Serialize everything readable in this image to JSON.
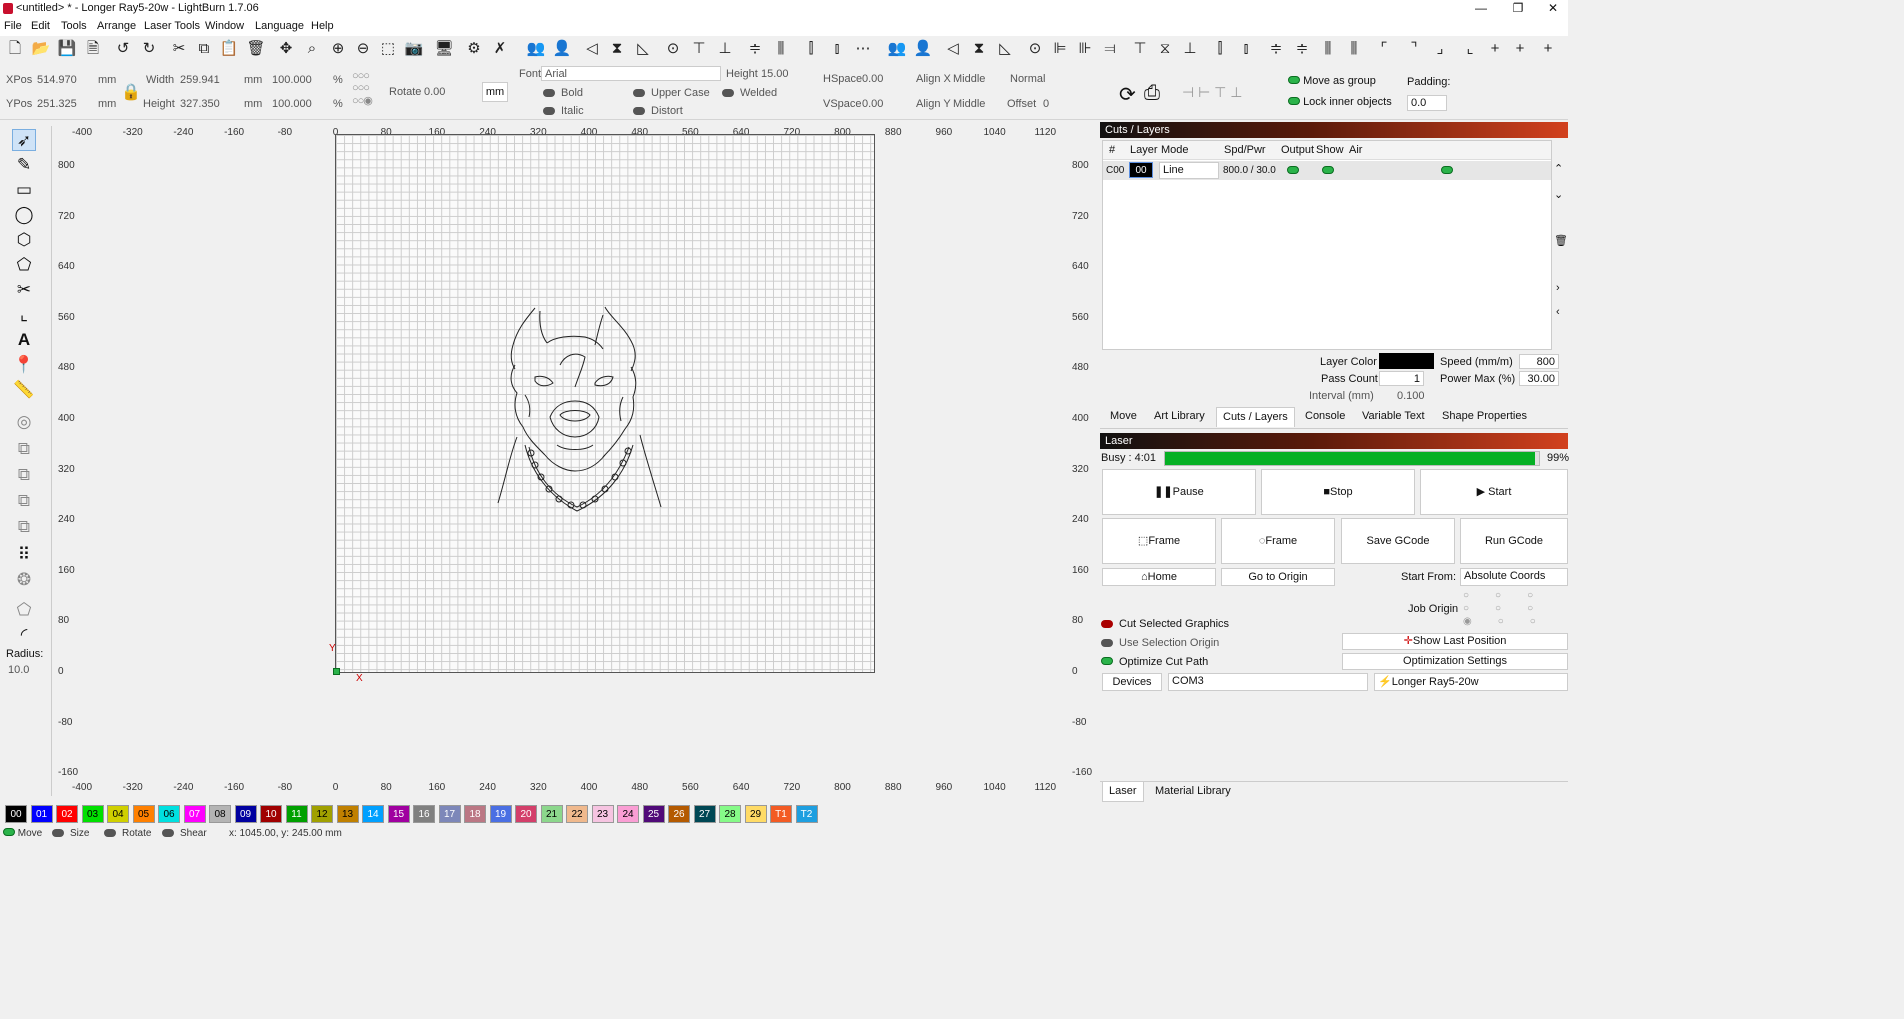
{
  "window": {
    "title": "<untitled> * - Longer Ray5-20w - LightBurn 1.7.06",
    "minimize": "—",
    "restore": "❐",
    "close": "✕"
  },
  "menu": [
    "File",
    "Edit",
    "Tools",
    "Arrange",
    "Laser Tools",
    "Window",
    "Language",
    "Help"
  ],
  "props": {
    "xpos_label": "XPos",
    "xpos": "514.970",
    "ypos_label": "YPos",
    "ypos": "251.325",
    "unit": "mm",
    "width_label": "Width",
    "width": "259.941",
    "height_label": "Height",
    "height": "327.350",
    "scale_w": "100.000",
    "scale_h": "100.000",
    "pct": "%",
    "rotate_label": "Rotate",
    "rotate": "0.00",
    "mm_btn": "mm",
    "font_label": "Font",
    "font": "Arial",
    "fheight_label": "Height",
    "fheight": "15.00",
    "hspace_label": "HSpace",
    "hspace": "0.00",
    "vspace_label": "VSpace",
    "vspace": "0.00",
    "alignx_label": "Align X",
    "alignx": "Middle",
    "aligny_label": "Align Y",
    "aligny": "Middle",
    "normal": "Normal",
    "offset_label": "Offset",
    "offset": "0",
    "bold": "Bold",
    "italic": "Italic",
    "upper": "Upper Case",
    "distort": "Distort",
    "welded": "Welded",
    "move_group": "Move as group",
    "lock_inner": "Lock inner objects",
    "padding_label": "Padding:",
    "padding": "0.0"
  },
  "ruler": {
    "top": [
      "-400",
      "-320",
      "-240",
      "-160",
      "-80",
      "0",
      "80",
      "160",
      "240",
      "320",
      "400",
      "480",
      "560",
      "640",
      "720",
      "800",
      "880",
      "960",
      "1040",
      "1120"
    ],
    "left": [
      "800",
      "720",
      "640",
      "560",
      "480",
      "400",
      "320",
      "240",
      "160",
      "80",
      "0",
      "-80",
      "-160"
    ]
  },
  "canvas": {
    "y_axis": "Y",
    "x_axis": "X"
  },
  "left": {
    "radius_label": "Radius:",
    "radius": "10.0"
  },
  "layers": {
    "title": "Cuts / Layers",
    "headers": [
      "#",
      "Layer",
      "Mode",
      "Spd/Pwr",
      "Output",
      "Show",
      "Air"
    ],
    "row": {
      "num": "C00",
      "layer": "00",
      "mode": "Line",
      "spdpwr": "800.0 / 30.0"
    },
    "layer_color_label": "Layer Color",
    "speed_label": "Speed (mm/m)",
    "speed": "800",
    "pass_label": "Pass Count",
    "pass": "1",
    "power_label": "Power Max (%)",
    "power": "30.00",
    "interval_label": "Interval (mm)",
    "interval": "0.100"
  },
  "tabs1": [
    "Move",
    "Art Library",
    "Cuts / Layers",
    "Console",
    "Variable Text",
    "Shape Properties"
  ],
  "laser": {
    "title": "Laser",
    "busy": "Busy : 4:01",
    "progress": 0.99,
    "progress_label": "99%",
    "pause": "Pause",
    "stop": "Stop",
    "start": "Start",
    "frame1": "Frame",
    "frame2": "Frame",
    "save_gcode": "Save GCode",
    "run_gcode": "Run GCode",
    "home": "Home",
    "go_origin": "Go to Origin",
    "start_from_label": "Start From:",
    "start_from": "Absolute Coords",
    "job_origin": "Job Origin",
    "cut_selected": "Cut Selected Graphics",
    "use_selection": "Use Selection Origin",
    "optimize": "Optimize Cut Path",
    "show_last": "Show Last Position",
    "opt_settings": "Optimization Settings",
    "devices": "Devices",
    "port": "COM3",
    "device": "Longer Ray5-20w"
  },
  "tabs2": [
    "Laser",
    "Material Library"
  ],
  "palette": [
    {
      "l": "00",
      "c": "#000000",
      "t": "#ffffff"
    },
    {
      "l": "01",
      "c": "#0000ff",
      "t": "#ffffff"
    },
    {
      "l": "02",
      "c": "#ff0000",
      "t": "#ffffff"
    },
    {
      "l": "03",
      "c": "#00e000",
      "t": "#000000"
    },
    {
      "l": "04",
      "c": "#d0d000",
      "t": "#000000"
    },
    {
      "l": "05",
      "c": "#ff8000",
      "t": "#000000"
    },
    {
      "l": "06",
      "c": "#00e0e0",
      "t": "#000000"
    },
    {
      "l": "07",
      "c": "#ff00ff",
      "t": "#ffffff"
    },
    {
      "l": "08",
      "c": "#b4b4b4",
      "t": "#000000"
    },
    {
      "l": "09",
      "c": "#0000a0",
      "t": "#ffffff"
    },
    {
      "l": "10",
      "c": "#a00000",
      "t": "#ffffff"
    },
    {
      "l": "11",
      "c": "#00a000",
      "t": "#ffffff"
    },
    {
      "l": "12",
      "c": "#a0a000",
      "t": "#000000"
    },
    {
      "l": "13",
      "c": "#c08000",
      "t": "#000000"
    },
    {
      "l": "14",
      "c": "#00a0ff",
      "t": "#ffffff"
    },
    {
      "l": "15",
      "c": "#a000a0",
      "t": "#ffffff"
    },
    {
      "l": "16",
      "c": "#808080",
      "t": "#ffffff"
    },
    {
      "l": "17",
      "c": "#7d87b9",
      "t": "#ffffff"
    },
    {
      "l": "18",
      "c": "#bb7784",
      "t": "#ffffff"
    },
    {
      "l": "19",
      "c": "#4a6fe3",
      "t": "#ffffff"
    },
    {
      "l": "20",
      "c": "#d33f6a",
      "t": "#ffffff"
    },
    {
      "l": "21",
      "c": "#8cd78c",
      "t": "#000000"
    },
    {
      "l": "22",
      "c": "#f0b98d",
      "t": "#000000"
    },
    {
      "l": "23",
      "c": "#f6c4e1",
      "t": "#000000"
    },
    {
      "l": "24",
      "c": "#fa9ed4",
      "t": "#000000"
    },
    {
      "l": "25",
      "c": "#500a78",
      "t": "#ffffff"
    },
    {
      "l": "26",
      "c": "#b45a00",
      "t": "#ffffff"
    },
    {
      "l": "27",
      "c": "#004754",
      "t": "#ffffff"
    },
    {
      "l": "28",
      "c": "#86fa88",
      "t": "#000000"
    },
    {
      "l": "29",
      "c": "#ffdb66",
      "t": "#000000"
    },
    {
      "l": "T1",
      "c": "#f35b24",
      "t": "#ffffff"
    },
    {
      "l": "T2",
      "c": "#1e9fe0",
      "t": "#ffffff"
    }
  ],
  "status": {
    "move": "Move",
    "size": "Size",
    "rotate": "Rotate",
    "shear": "Shear",
    "coords": "x: 1045.00, y: 245.00 mm"
  }
}
